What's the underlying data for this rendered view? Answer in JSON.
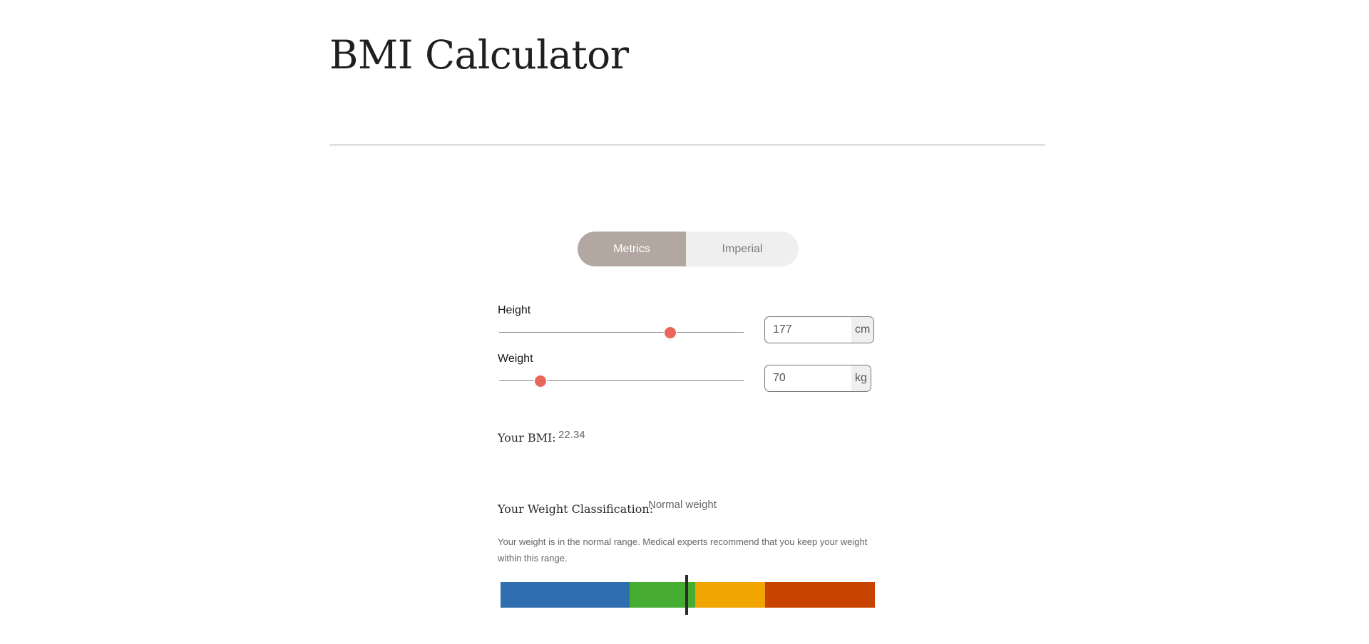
{
  "page": {
    "title": "BMI Calculator"
  },
  "unit_toggle": {
    "options": [
      {
        "label": "Metrics",
        "selected": true
      },
      {
        "label": "Imperial",
        "selected": false
      }
    ]
  },
  "height": {
    "label": "Height",
    "value": "177",
    "unit": "cm",
    "slider_fraction": 0.7
  },
  "weight": {
    "label": "Weight",
    "value": "70",
    "unit": "kg",
    "slider_fraction": 0.17
  },
  "result": {
    "bmi_label": "Your BMI:",
    "bmi_value": "22.34",
    "classification_label": "Your Weight Classification:",
    "classification_value": "Normal weight",
    "description": "Your weight is in the normal range. Medical experts recommend that you keep your weight within this range."
  },
  "bmi_scale": {
    "marker_fraction": 0.497,
    "segments": [
      {
        "fraction": 0.345,
        "color": "#2f6faf"
      },
      {
        "fraction": 0.175,
        "color": "#47ac32"
      },
      {
        "fraction": 0.187,
        "color": "#f0a500"
      },
      {
        "fraction": 0.293,
        "color": "#c84300"
      }
    ]
  },
  "colors": {
    "toggle_active": "#b2a8a1",
    "toggle_inactive": "#efeff0",
    "slider_thumb": "#e8675a"
  }
}
